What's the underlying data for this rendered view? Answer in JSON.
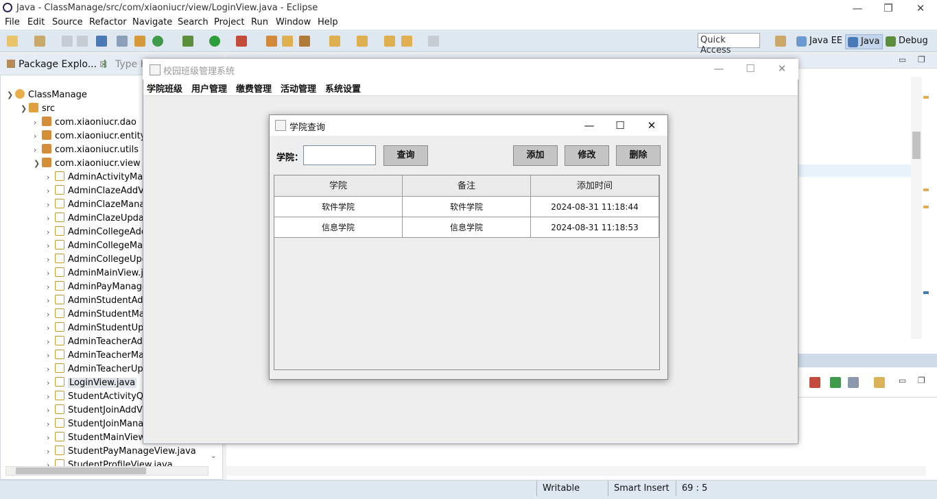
{
  "eclipse": {
    "title": "Java - ClassManage/src/com/xiaoniucr/view/LoginView.java - Eclipse",
    "menu": [
      "File",
      "Edit",
      "Source",
      "Refactor",
      "Navigate",
      "Search",
      "Project",
      "Run",
      "Window",
      "Help"
    ],
    "quick_access": "Quick Access",
    "perspectives": [
      "Java EE",
      "Java",
      "Debug"
    ],
    "left_tabs": [
      "Package Explo...",
      "Type H"
    ],
    "tree": {
      "project": "ClassManage",
      "src": "src",
      "packages": [
        "com.xiaoniucr.dao",
        "com.xiaoniucr.entity",
        "com.xiaoniucr.utils",
        "com.xiaoniucr.view"
      ],
      "files": [
        "AdminActivityMan",
        "AdminClazeAddVi",
        "AdminClazeMana",
        "AdminClazeUpdat",
        "AdminCollegeAdc",
        "AdminCollegeMar",
        "AdminCollegeUpc",
        "AdminMainView.ja",
        "AdminPayManage",
        "AdminStudentAdc",
        "AdminStudentMar",
        "AdminStudentUpc",
        "AdminTeacherAdc",
        "AdminTeacherMa",
        "AdminTeacherUpc",
        "LoginView.java",
        "StudentActivityQu",
        "StudentJoinAddVi",
        "StudentJoinManag",
        "StudentMainView.",
        "StudentPayManageView.java",
        "StudentProfileView.java"
      ],
      "selected": "LoginView.java"
    },
    "status": {
      "writable": "Writable",
      "insert_mode": "Smart Insert",
      "position": "69 : 5"
    }
  },
  "app": {
    "title": "校园班级管理系统",
    "menu": [
      "学院班级",
      "用户管理",
      "缴费管理",
      "活动管理",
      "系统设置"
    ]
  },
  "dialog": {
    "title": "学院查询",
    "college_label": "学院：",
    "college_value": "",
    "query_button": "查询",
    "add_button": "添加",
    "edit_button": "修改",
    "delete_button": "删除",
    "table": {
      "headers": [
        "学院",
        "备注",
        "添加时间"
      ],
      "rows": [
        [
          "软件学院",
          "软件学院",
          "2024-08-31 11:18:44"
        ],
        [
          "信息学院",
          "信息学院",
          "2024-08-31 11:18:53"
        ]
      ]
    }
  }
}
